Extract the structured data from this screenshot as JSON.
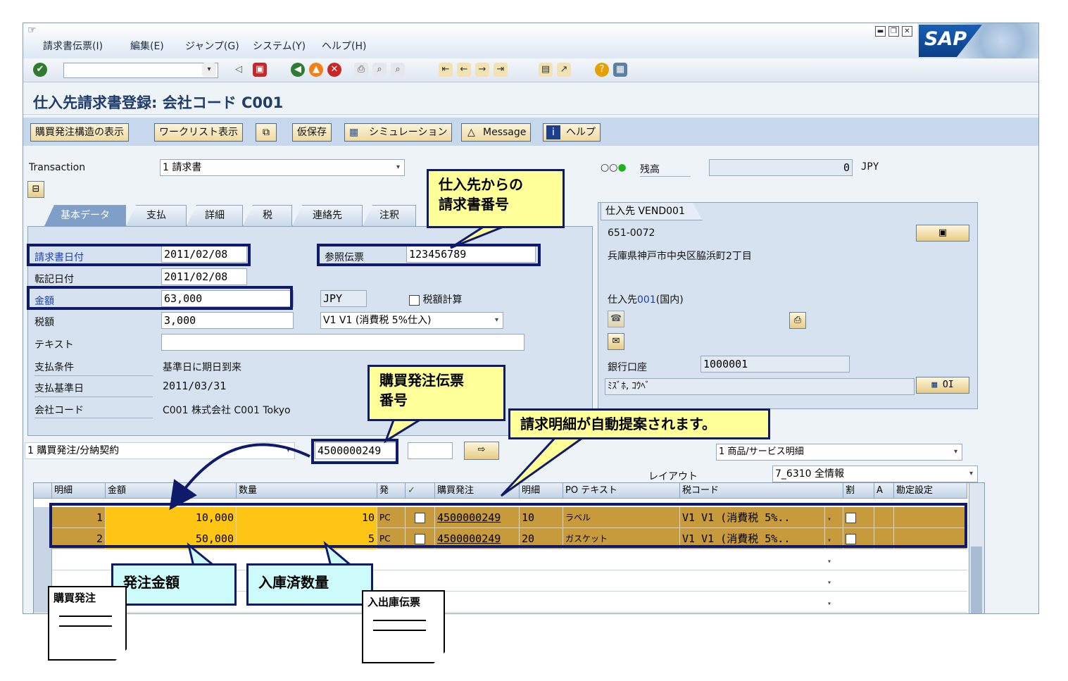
{
  "menu": [
    "請求書伝票(I)",
    "編集(E)",
    "ジャンプ(G)",
    "システム(Y)",
    "ヘルプ(H)"
  ],
  "logo_text": "SAP",
  "title": "仕入先請求書登録: 会社コード C001",
  "app_toolbar": {
    "po_structure": "購買発注構造の表示",
    "worklist": "ワークリスト表示",
    "hold": "仮保存",
    "simulation": "シミュレーション",
    "message": "Message",
    "help": "ヘルプ"
  },
  "header": {
    "transaction_label": "Transaction",
    "transaction_value": "1 請求書",
    "balance_label": "残高",
    "balance_value": "0",
    "balance_currency": "JPY"
  },
  "tabs": [
    "基本データ",
    "支払",
    "詳細",
    "税",
    "連絡先",
    "注釈"
  ],
  "form": {
    "invoice_date_label": "請求書日付",
    "invoice_date": "2011/02/08",
    "posting_date_label": "転記日付",
    "posting_date": "2011/02/08",
    "amount_label": "金額",
    "amount": "63,000",
    "currency": "JPY",
    "calc_tax_label": "税額計算",
    "tax_label": "税額",
    "tax_amount": "3,000",
    "tax_code": "V1 V1 (消費税 5%仕入)",
    "text_label": "テキスト",
    "payment_terms_label": "支払条件",
    "payment_terms": "基準日に期日到来",
    "baseline_date_label": "支払基準日",
    "baseline_date": "2011/03/31",
    "company_code_label": "会社コード",
    "company_code": "C001 株式会社 C001 Tokyo",
    "reference_label": "参照伝票",
    "reference": "123456789"
  },
  "vendor": {
    "tab_label": "仕入先 VEND001",
    "postal": "651-0072",
    "address": "兵庫県神戸市中央区脇浜町2丁目",
    "vendor_name_prefix": "仕入先",
    "vendor_name_blue": "001",
    "vendor_name_suffix": "(国内)",
    "bank_label": "銀行口座",
    "bank_value": "1000001",
    "bank_name": "ﾐｽﾞﾎ, ｺｳﾍﾞ",
    "oi_label": "OI"
  },
  "po_ref": {
    "type": "1 購買発注/分納契約",
    "po_number": "4500000249",
    "item_type": "1 商品/サービス明細",
    "layout_label": "レイアウト",
    "layout_value": "7_6310 全情報"
  },
  "table": {
    "headers": [
      "明細",
      "金額",
      "数量",
      "発",
      "",
      "購買発注",
      "明細",
      "PO テキスト",
      "税コード",
      "割",
      "A",
      "勘定設定"
    ],
    "rows": [
      {
        "item": "1",
        "amount": "10,000",
        "qty": "10",
        "unit": "PC",
        "po": "4500000249",
        "po_item": "10",
        "text": "ラベル",
        "tax": "V1 V1 (消費税 5%.."
      },
      {
        "item": "2",
        "amount": "50,000",
        "qty": "5",
        "unit": "PC",
        "po": "4500000249",
        "po_item": "20",
        "text": "ガスケット",
        "tax": "V1 V1 (消費税 5%.."
      }
    ]
  },
  "annotations": {
    "vendor_invoice_no": [
      "仕入先からの",
      "請求書番号"
    ],
    "po_doc_no": [
      "購買発注伝票",
      "番号"
    ],
    "auto_propose": "請求明細が自動提案されます。",
    "order_amount": "発注金額",
    "received_qty": "入庫済数量",
    "doc_po": "購買発注",
    "doc_gr": "入出庫伝票"
  }
}
